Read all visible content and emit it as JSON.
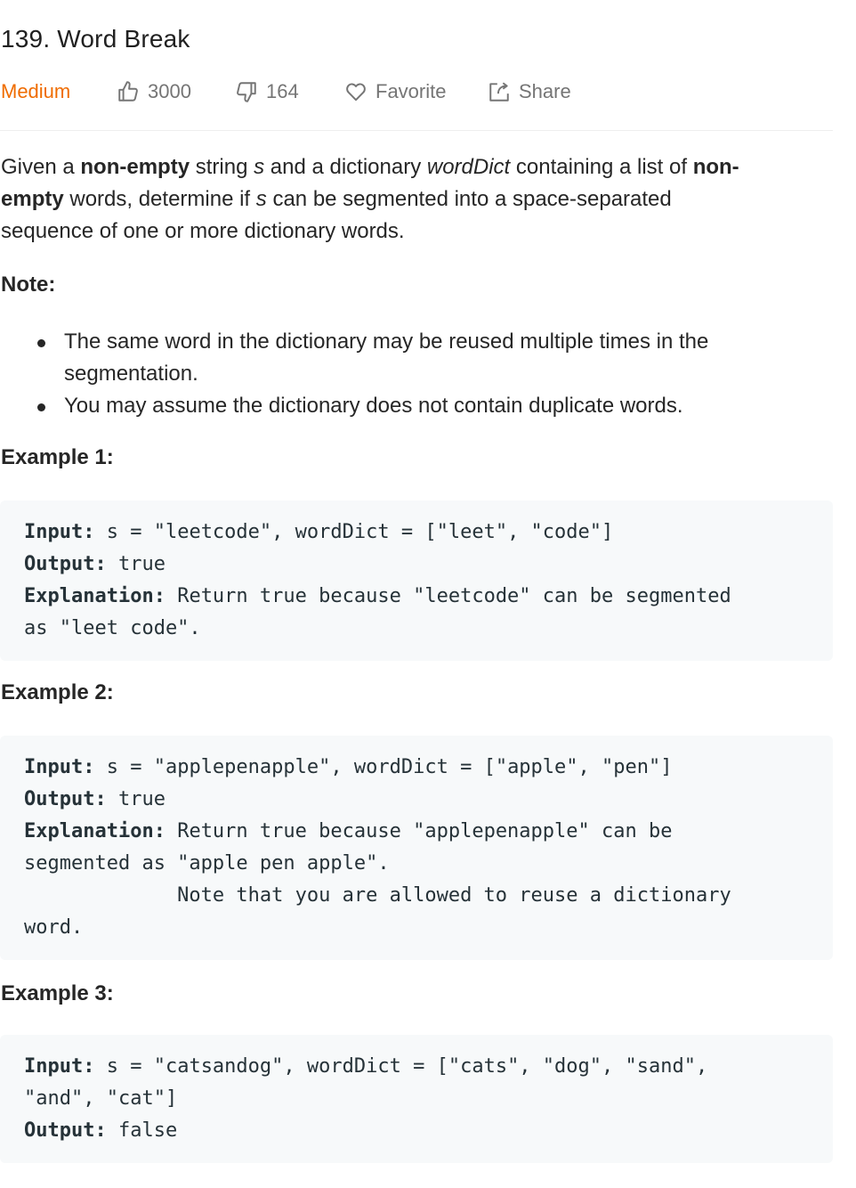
{
  "problem": {
    "title": "139. Word Break",
    "difficulty": "Medium",
    "likes": "3000",
    "dislikes": "164",
    "favorite_label": "Favorite",
    "share_label": "Share"
  },
  "description": {
    "p1": "Given a ",
    "b1": "non-empty",
    "p2": " string ",
    "i1": "s",
    "p3": " and a dictionary ",
    "i2": "wordDict",
    "p4": " containing a list of ",
    "b2": "non-",
    "b3": "empty",
    "p5": " words, determine if ",
    "i3": "s",
    "p6": " can be segmented into a space-separated",
    "line3": "sequence of one or more dictionary words."
  },
  "note": {
    "label": "Note:",
    "items": [
      "The same word in the dictionary may be reused multiple times in the segmentation.",
      "You may assume the dictionary does not contain duplicate words."
    ]
  },
  "examples": [
    {
      "label": "Example 1:",
      "input_label": "Input:",
      "input": " s = \"leetcode\", wordDict = [\"leet\", \"code\"]",
      "output_label": "Output:",
      "output": " true",
      "explanation_label": "Explanation:",
      "explanation": " Return true because \"leetcode\" can be segmented",
      "explanation_cont": "as \"leet code\"."
    },
    {
      "label": "Example 2:",
      "input_label": "Input:",
      "input": " s = \"applepenapple\", wordDict = [\"apple\", \"pen\"]",
      "output_label": "Output:",
      "output": " true",
      "explanation_label": "Explanation:",
      "explanation": " Return true because \"applepenapple\" can be",
      "explanation_cont": "segmented as \"apple pen apple\".",
      "explanation_cont2": "             Note that you are allowed to reuse a dictionary",
      "explanation_cont3": "word."
    },
    {
      "label": "Example 3:",
      "input_label": "Input:",
      "input": " s = \"catsandog\", wordDict = [\"cats\", \"dog\", \"sand\",",
      "input_cont": "\"and\", \"cat\"]",
      "output_label": "Output:",
      "output": " false"
    }
  ],
  "colors": {
    "difficulty_medium": "#ef6c00",
    "meta_text": "#757575",
    "code_background": "#f7f9fa",
    "divider": "#eeeeee"
  },
  "icons": [
    "thumbs-up-icon",
    "thumbs-down-icon",
    "heart-icon",
    "share-icon"
  ]
}
